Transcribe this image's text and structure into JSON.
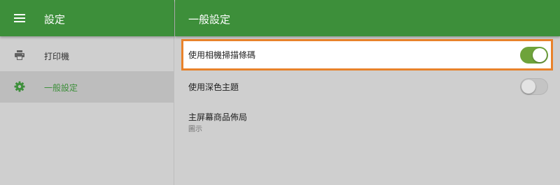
{
  "sidebar": {
    "title": "設定",
    "items": [
      {
        "label": "打印機",
        "icon": "printer-icon"
      },
      {
        "label": "一般設定",
        "icon": "gear-icon"
      }
    ]
  },
  "main": {
    "title": "一般設定",
    "settings": [
      {
        "label": "使用相機掃描條碼",
        "toggle": "on"
      },
      {
        "label": "使用深色主題",
        "toggle": "off"
      }
    ],
    "layout": {
      "label": "主屏幕商品佈局",
      "value": "圖示"
    }
  },
  "colors": {
    "appbar": "#3d8f3a",
    "accent": "#6ea33b",
    "highlight_border": "#e8822b",
    "background": "#cfcfcf"
  }
}
